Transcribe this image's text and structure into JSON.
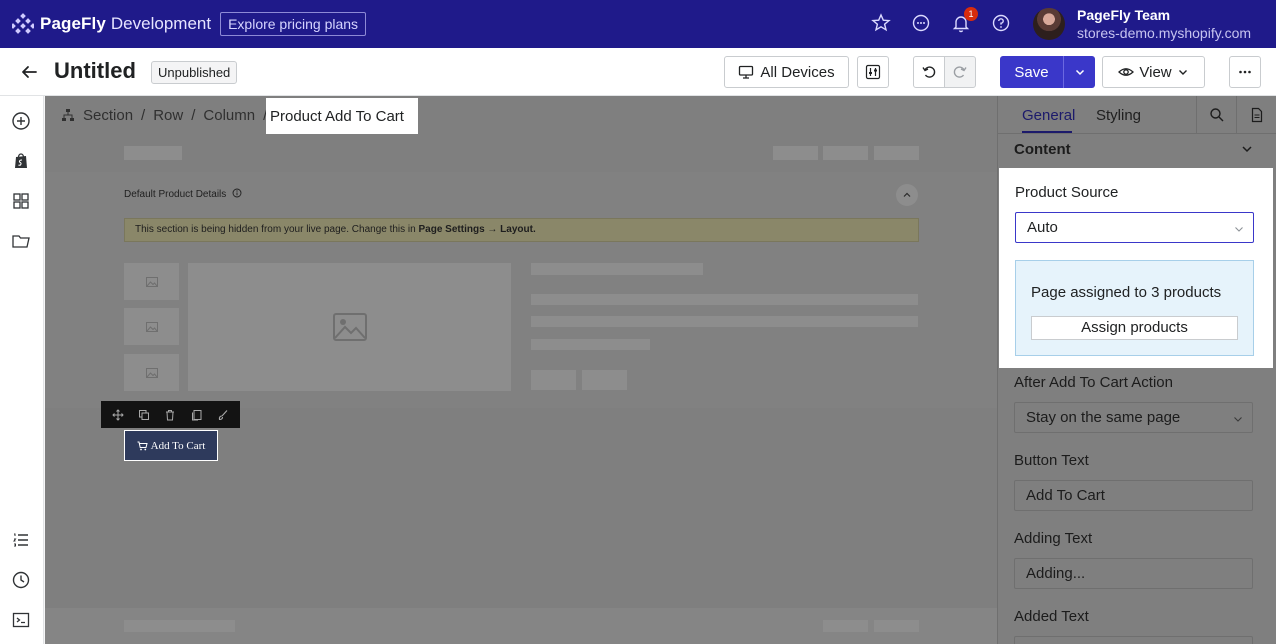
{
  "topbar": {
    "brand_name": "PageFly",
    "brand_env": "Development",
    "pricing_label": "Explore pricing plans",
    "notification_count": "1",
    "user_name": "PageFly Team",
    "user_store": "stores-demo.myshopify.com"
  },
  "pagebar": {
    "title": "Untitled",
    "status": "Unpublished",
    "devices_label": "All Devices",
    "save_label": "Save",
    "view_label": "View"
  },
  "breadcrumb": {
    "items": [
      "Section",
      "Row",
      "Column"
    ],
    "separator": "/",
    "active": "Product Add To Cart"
  },
  "canvas": {
    "section_title": "Default Product Details",
    "warning_text": "This section is being hidden from your live page. Change this in ",
    "warning_bold": "Page Settings → Layout.",
    "add_to_cart_label": "Add To Cart"
  },
  "panel": {
    "tabs": [
      "General",
      "Styling"
    ],
    "content_heading": "Content",
    "product_source_label": "Product Source",
    "product_source_value": "Auto",
    "info_text": "Page assigned to 3 products",
    "assign_button": "Assign products",
    "after_action_label": "After Add To Cart Action",
    "after_action_value": "Stay on the same page",
    "button_text_label": "Button Text",
    "button_text_value": "Add To Cart",
    "adding_text_label": "Adding Text",
    "adding_text_value": "Adding...",
    "added_text_label": "Added Text"
  },
  "colors": {
    "topbar": "#1f1a8a",
    "primary": "#3a37c9",
    "overlay": "#7f7f7f"
  }
}
